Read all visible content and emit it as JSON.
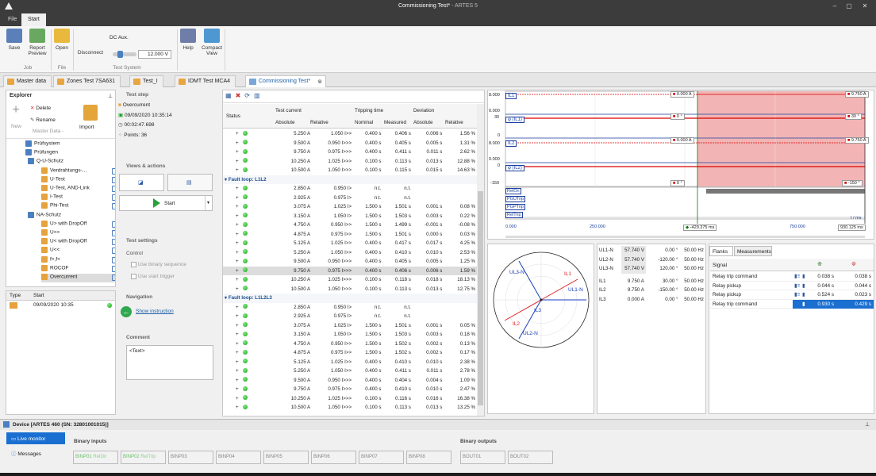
{
  "window": {
    "title": "Commissioning Test*",
    "app": " - ARTES 5",
    "min": "–",
    "max": "▢",
    "close": "✕"
  },
  "menu": {
    "file": "File",
    "start": "Start"
  },
  "ribbon": {
    "save": "Save",
    "report": "Report",
    "preview": "Preview",
    "open": "Open",
    "disconnect": "Disconnect",
    "dc_aux": "DC Aux.",
    "dc_value": "12.000 V",
    "help": "Help",
    "compact": "Compact",
    "view": "View",
    "grp_job": "Job",
    "grp_file": "File",
    "grp_test": "Test System"
  },
  "tabs": [
    "Master data",
    "Zones Test 7SA631",
    "Test_I",
    "IDMT Test MCA4",
    "Commissioning Test*"
  ],
  "explorer": {
    "title": "Explorer",
    "delete": "Delete",
    "rename": "Rename",
    "new": "New",
    "master": "Master Data -",
    "import": "Import",
    "items": [
      {
        "label": "Prüfsystem",
        "lvl": 2,
        "color": "#4a7fc1"
      },
      {
        "label": "Prüfungen",
        "lvl": 2,
        "color": "#4a7fc1"
      },
      {
        "label": "Q-U-Schutz",
        "lvl": 3,
        "color": "#4a7fc1"
      },
      {
        "label": "Verdrahtungs-...",
        "lvl": 4,
        "color": "#e6a23c"
      },
      {
        "label": "U-Test",
        "lvl": 4,
        "color": "#e6a23c"
      },
      {
        "label": "U-Test, AND-Link",
        "lvl": 4,
        "color": "#e6a23c"
      },
      {
        "label": "I-Test",
        "lvl": 4,
        "color": "#e6a23c"
      },
      {
        "label": "Phi-Test",
        "lvl": 4,
        "color": "#e6a23c"
      },
      {
        "label": "NA-Schutz",
        "lvl": 3,
        "color": "#4a7fc1"
      },
      {
        "label": "U> with DropOff",
        "lvl": 4,
        "color": "#e6a23c"
      },
      {
        "label": "U>>",
        "lvl": 4,
        "color": "#e6a23c"
      },
      {
        "label": "U< with DropOff",
        "lvl": 4,
        "color": "#e6a23c"
      },
      {
        "label": "U<<",
        "lvl": 4,
        "color": "#e6a23c"
      },
      {
        "label": "f>,f<",
        "lvl": 4,
        "color": "#e6a23c"
      },
      {
        "label": "ROCOF",
        "lvl": 4,
        "color": "#e6a23c"
      },
      {
        "label": "Overcurrent",
        "lvl": 4,
        "color": "#e6a23c",
        "selected": true
      }
    ],
    "hist_type": "Type",
    "hist_start": "Start",
    "hist_date": "09/09/2020 10:35"
  },
  "teststep": {
    "title": "Test step",
    "name": "Overcurrent",
    "date": "09/09/2020 10:35:14",
    "duration": "00:02:47.698",
    "points": "Points: 36",
    "views": "Views & actions",
    "start": "Start",
    "settings": "Test settings",
    "control": "Control",
    "binseq": "Use binary sequence",
    "starttrig": "Use start trigger",
    "nav": "Navigation",
    "showinstr": "Show instruction",
    "comment": "Comment",
    "comment_text": "<Text>"
  },
  "table": {
    "status": "Status",
    "test_current": "Test current",
    "tripping": "Tripping time",
    "deviation": "Deviation",
    "absolute": "Absolute",
    "relative": "Relative",
    "nominal": "Nominal",
    "measured": "Measured",
    "abs2": "Absolute",
    "rel2": "Relative",
    "rows": [
      {
        "t": "r",
        "a": "5.250 A",
        "r": "1.050 I>>",
        "n": "0.400 s",
        "m": "0.406 s",
        "da": "0.006 s",
        "dr": "1.56 %"
      },
      {
        "t": "r",
        "a": "9.500 A",
        "r": "0.950 I>>>",
        "n": "0.400 s",
        "m": "0.405 s",
        "da": "0.005 s",
        "dr": "1.31 %"
      },
      {
        "t": "r",
        "a": "9.750 A",
        "r": "0.975 I>>>",
        "n": "0.400 s",
        "m": "0.411 s",
        "da": "0.011 s",
        "dr": "2.62 %"
      },
      {
        "t": "r",
        "a": "10.250 A",
        "r": "1.025 I>>>",
        "n": "0.100 s",
        "m": "0.113 s",
        "da": "0.013 s",
        "dr": "12.88 %"
      },
      {
        "t": "r",
        "a": "10.500 A",
        "r": "1.050 I>>>",
        "n": "0.100 s",
        "m": "0.115 s",
        "da": "0.015 s",
        "dr": "14.63 %"
      },
      {
        "t": "g",
        "label": "Fault loop: L1L2"
      },
      {
        "t": "r",
        "a": "2.850 A",
        "r": "0.950 I>",
        "n": "n.t.",
        "m": "n.t.",
        "da": "",
        "dr": ""
      },
      {
        "t": "r",
        "a": "2.925 A",
        "r": "0.975 I>",
        "n": "n.t.",
        "m": "n.t.",
        "da": "",
        "dr": ""
      },
      {
        "t": "r",
        "a": "3.075 A",
        "r": "1.025 I>",
        "n": "1.500 s",
        "m": "1.501 s",
        "da": "0.001 s",
        "dr": "0.08 %"
      },
      {
        "t": "r",
        "a": "3.150 A",
        "r": "1.050 I>",
        "n": "1.500 s",
        "m": "1.503 s",
        "da": "0.003 s",
        "dr": "0.22 %"
      },
      {
        "t": "r",
        "a": "4.750 A",
        "r": "0.950 I>>",
        "n": "1.500 s",
        "m": "1.499 s",
        "da": "-0.001 s",
        "dr": "-0.08 %"
      },
      {
        "t": "r",
        "a": "4.875 A",
        "r": "0.975 I>>",
        "n": "1.500 s",
        "m": "1.501 s",
        "da": "0.000 s",
        "dr": "0.03 %"
      },
      {
        "t": "r",
        "a": "5.125 A",
        "r": "1.025 I>>",
        "n": "0.400 s",
        "m": "0.417 s",
        "da": "0.017 s",
        "dr": "4.25 %"
      },
      {
        "t": "r",
        "a": "5.250 A",
        "r": "1.050 I>>",
        "n": "0.400 s",
        "m": "0.410 s",
        "da": "0.010 s",
        "dr": "2.53 %"
      },
      {
        "t": "r",
        "a": "9.500 A",
        "r": "0.950 I>>>",
        "n": "0.400 s",
        "m": "0.405 s",
        "da": "0.005 s",
        "dr": "1.25 %"
      },
      {
        "t": "r",
        "sel": true,
        "a": "9.750 A",
        "r": "0.975 I>>>",
        "n": "0.400 s",
        "m": "0.406 s",
        "da": "0.006 s",
        "dr": "1.59 %"
      },
      {
        "t": "r",
        "a": "10.250 A",
        "r": "1.025 I>>>",
        "n": "0.100 s",
        "m": "0.118 s",
        "da": "0.018 s",
        "dr": "18.13 %"
      },
      {
        "t": "r",
        "a": "10.500 A",
        "r": "1.050 I>>>",
        "n": "0.100 s",
        "m": "0.113 s",
        "da": "0.013 s",
        "dr": "12.75 %"
      },
      {
        "t": "g",
        "label": "Fault loop: L1L2L3"
      },
      {
        "t": "r",
        "a": "2.850 A",
        "r": "0.950 I>",
        "n": "n.t.",
        "m": "n.t.",
        "da": "",
        "dr": ""
      },
      {
        "t": "r",
        "a": "2.925 A",
        "r": "0.975 I>",
        "n": "n.t.",
        "m": "n.t.",
        "da": "",
        "dr": ""
      },
      {
        "t": "r",
        "a": "3.075 A",
        "r": "1.025 I>",
        "n": "1.500 s",
        "m": "1.501 s",
        "da": "0.001 s",
        "dr": "0.05 %"
      },
      {
        "t": "r",
        "a": "3.150 A",
        "r": "1.050 I>",
        "n": "1.500 s",
        "m": "1.503 s",
        "da": "0.003 s",
        "dr": "0.18 %"
      },
      {
        "t": "r",
        "a": "4.750 A",
        "r": "0.950 I>>",
        "n": "1.500 s",
        "m": "1.502 s",
        "da": "0.002 s",
        "dr": "0.13 %"
      },
      {
        "t": "r",
        "a": "4.875 A",
        "r": "0.975 I>>",
        "n": "1.500 s",
        "m": "1.502 s",
        "da": "0.002 s",
        "dr": "0.17 %"
      },
      {
        "t": "r",
        "a": "5.125 A",
        "r": "1.025 I>>",
        "n": "0.400 s",
        "m": "0.410 s",
        "da": "0.010 s",
        "dr": "2.38 %"
      },
      {
        "t": "r",
        "a": "5.250 A",
        "r": "1.050 I>>",
        "n": "0.400 s",
        "m": "0.411 s",
        "da": "0.011 s",
        "dr": "2.78 %"
      },
      {
        "t": "r",
        "a": "9.500 A",
        "r": "0.950 I>>>",
        "n": "0.400 s",
        "m": "0.404 s",
        "da": "0.004 s",
        "dr": "1.09 %"
      },
      {
        "t": "r",
        "a": "9.750 A",
        "r": "0.975 I>>>",
        "n": "0.400 s",
        "m": "0.410 s",
        "da": "0.010 s",
        "dr": "2.47 %"
      },
      {
        "t": "r",
        "a": "10.250 A",
        "r": "1.025 I>>>",
        "n": "0.100 s",
        "m": "0.116 s",
        "da": "0.016 s",
        "dr": "16.38 %"
      },
      {
        "t": "r",
        "a": "10.500 A",
        "r": "1.050 I>>>",
        "n": "0.100 s",
        "m": "0.113 s",
        "da": "0.013 s",
        "dr": "13.25 %"
      }
    ]
  },
  "scope": {
    "ch_il1": "IL1",
    "ch_phiil1": "φ (IL1)",
    "ch_il2": "IL2",
    "ch_phiil2": "φ (IL2)",
    "y1a": "8.000",
    "y1b": "0.000",
    "y1c": "30",
    "y1d": "0",
    "y2a": "8.000",
    "y2b": "0.000",
    "y2c": "0",
    "y2d": "-150",
    "m_0a": "0.000 A",
    "m_975": "9.750 A",
    "m_0deg": "0 °",
    "m_30": "30 °",
    "m_n150": "-150 °",
    "bins": [
      "RelOn",
      "PGUTrip",
      "PGPTrip",
      "RelTrip"
    ],
    "xt0": "0.000",
    "xt1": "250.000",
    "xt2": "500.000",
    "xt3": "750.000",
    "tms": "t / ms",
    "cursor1": "-429.375 ms",
    "cursor2": "930.125 ms"
  },
  "vector": {
    "il1": "IL1",
    "il2": "IL2",
    "il3": "IL3",
    "ul1": "UL1-N",
    "ul2": "UL2-N",
    "ul3": "UL3-N"
  },
  "measure": [
    {
      "n": "UL1-N",
      "v": "57.740 V",
      "p": "0.00 °",
      "f": "50.00 Hz"
    },
    {
      "n": "UL2-N",
      "v": "57.740 V",
      "p": "-120.00 °",
      "f": "50.00 Hz"
    },
    {
      "n": "UL3-N",
      "v": "57.740 V",
      "p": "120.00 °",
      "f": "50.00 Hz"
    },
    {
      "n": "IL1",
      "v": "9.750 A",
      "p": "30.00 °",
      "f": "50.00 Hz"
    },
    {
      "n": "IL2",
      "v": "9.750 A",
      "p": "-150.00 °",
      "f": "50.00 Hz"
    },
    {
      "n": "IL3",
      "v": "0.000 A",
      "p": "0.00 °",
      "f": "50.00 Hz"
    }
  ],
  "flanks": {
    "tab1": "Flanks",
    "tab2": "Measurements",
    "signal": "Signal",
    "rows": [
      {
        "s": "Relay trip command",
        "a": "0.038 s",
        "b": "0.038 s"
      },
      {
        "s": "Relay pickup",
        "a": "0.044 s",
        "b": "0.044 s"
      },
      {
        "s": "Relay pickup",
        "a": "0.524 s",
        "b": "0.023 s"
      },
      {
        "s": "Relay trip command",
        "a": "0.930 s",
        "b": "0.429 s",
        "sel": true
      }
    ]
  },
  "device": {
    "title": "Device [ARTES 460 (SN: 32801001015)]",
    "live": "Live monitor",
    "messages": "Messages",
    "binin": "Binary inputs",
    "binout": "Binary outputs",
    "inputs": [
      {
        "n": "BINP01",
        "l": "RelOn"
      },
      {
        "n": "BINP02",
        "l": "RelTrip"
      },
      {
        "n": "BINP03",
        "l": ""
      },
      {
        "n": "BINP04",
        "l": ""
      },
      {
        "n": "BINP05",
        "l": ""
      },
      {
        "n": "BINP06",
        "l": ""
      },
      {
        "n": "BINP07",
        "l": ""
      },
      {
        "n": "BINP08",
        "l": ""
      }
    ],
    "outputs": [
      "BOUT01",
      "BOUT02"
    ]
  }
}
